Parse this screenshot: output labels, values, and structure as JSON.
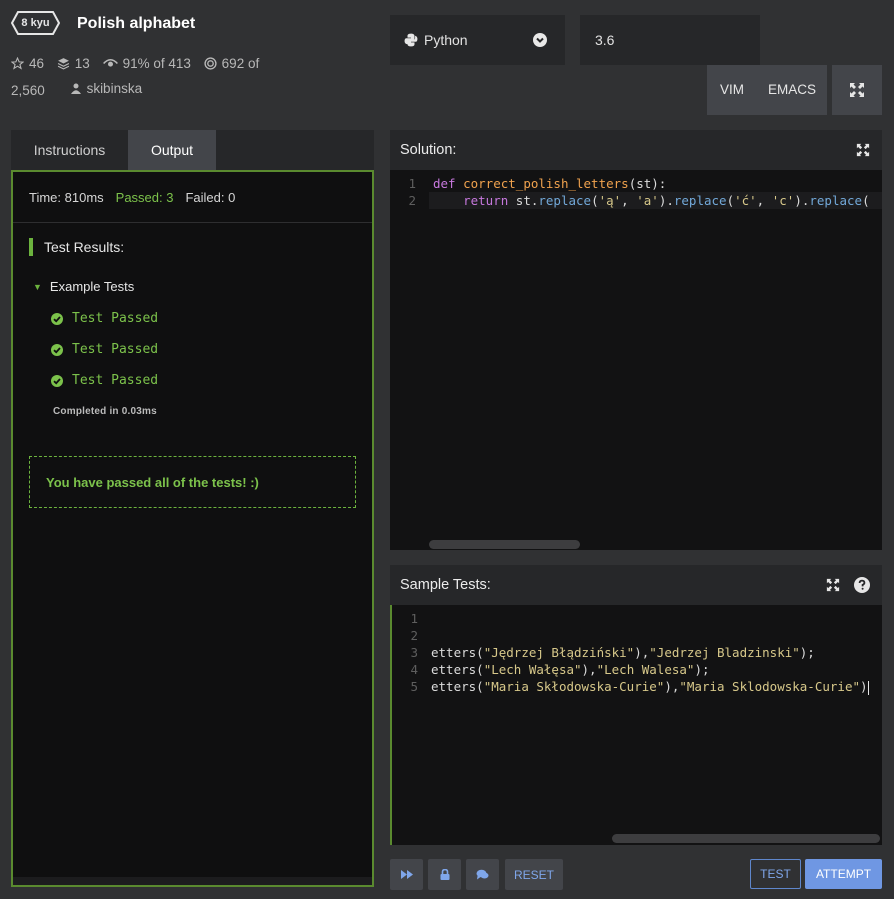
{
  "kata": {
    "rank": "8 kyu",
    "title": "Polish alphabet",
    "stats": {
      "stars": "46",
      "collections": "13",
      "satisfaction": "91% of 413",
      "completions_a": "692 of",
      "completions_b": "2,560",
      "author": "skibinska"
    }
  },
  "toolbar": {
    "language": "Python",
    "version": "3.6",
    "vim_label": "VIM",
    "emacs_label": "EMACS"
  },
  "left_panel": {
    "tabs": [
      "Instructions",
      "Output"
    ],
    "active_tab": "Output",
    "summary": {
      "time": "Time: 810ms",
      "passed": "Passed: 3",
      "failed": "Failed: 0"
    },
    "results_heading": "Test Results:",
    "group_label": "Example Tests",
    "tests": [
      "Test Passed",
      "Test Passed",
      "Test Passed"
    ],
    "completed": "Completed in 0.03ms",
    "passed_message": "You have passed all of the tests! :)"
  },
  "solution": {
    "heading": "Solution:",
    "line_numbers": [
      "1",
      "2"
    ]
  },
  "sample_tests": {
    "heading": "Sample Tests:",
    "line_numbers": [
      "1",
      "2",
      "3",
      "4",
      "5"
    ]
  },
  "actions": {
    "reset_label": "RESET",
    "test_label": "TEST",
    "attempt_label": "ATTEMPT"
  },
  "colors": {
    "accent_green": "#6cb33e",
    "accent_blue": "#6f97e3",
    "panel_dark": "#262729"
  }
}
